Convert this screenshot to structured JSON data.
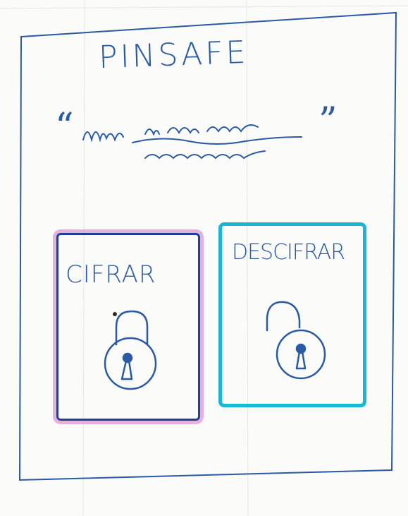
{
  "app": {
    "title": "PINSAFE",
    "message_input": {
      "open_quote": "“",
      "close_quote": "”",
      "content": "scribbled handwritten message placeholder"
    }
  },
  "actions": {
    "encrypt": {
      "label": "CIFRAR",
      "icon": "locked-padlock-icon",
      "border_color": "#223f96",
      "highlight_color": "#ce76c4"
    },
    "decrypt": {
      "label": "DESCIFRAR",
      "icon": "unlocked-padlock-icon",
      "border_color": "#16b8d6"
    }
  },
  "colors": {
    "ink": "#2a5aa3",
    "paper": "#fbfbf9"
  }
}
